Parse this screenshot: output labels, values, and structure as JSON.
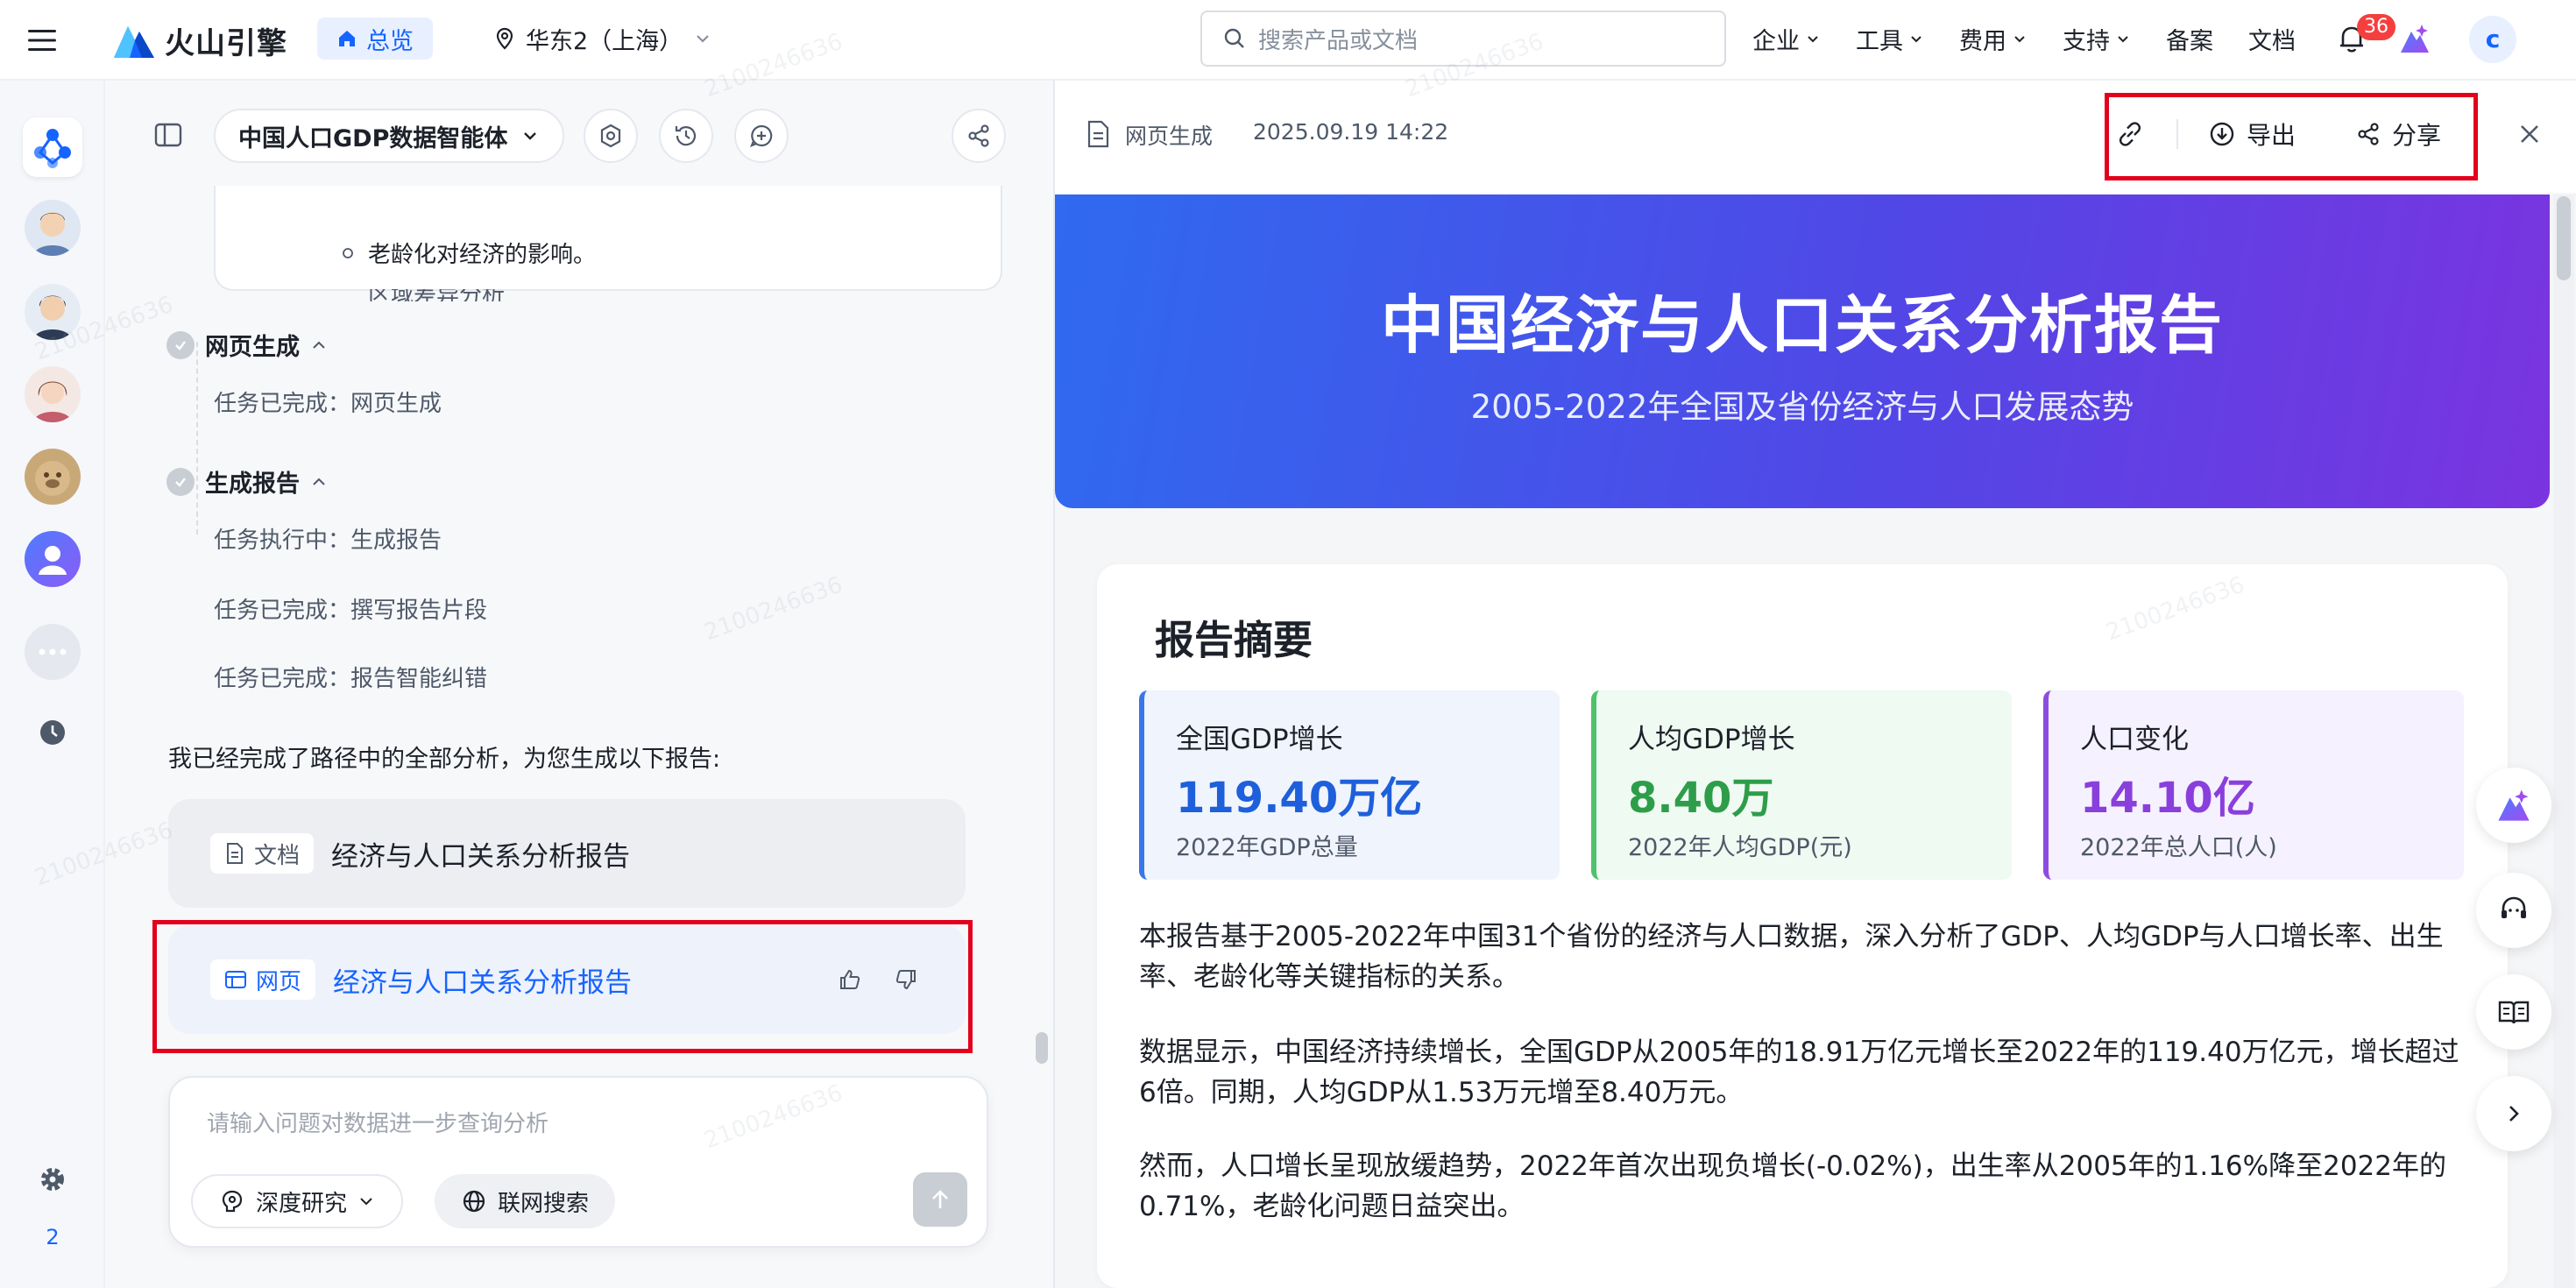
{
  "topnav": {
    "logo": "火山引擎",
    "home": "总览",
    "region": "华东2（上海）",
    "search_placeholder": "搜索产品或文档",
    "menu": [
      "企业",
      "工具",
      "费用",
      "支持"
    ],
    "links": [
      "备案",
      "文档"
    ],
    "notifications": "36",
    "user_initial": "c"
  },
  "rail": {
    "count": "2"
  },
  "chat": {
    "agent_name": "中国人口GDP数据智能体",
    "outline_item": "老龄化对经济的影响。",
    "outline_cut": "区域差异分析",
    "steps": [
      {
        "title": "网页生成",
        "tasks": [
          "任务已完成：网页生成"
        ]
      },
      {
        "title": "生成报告",
        "tasks": [
          "任务执行中：生成报告",
          "任务已完成：撰写报告片段",
          "任务已完成：报告智能纠错"
        ]
      }
    ],
    "summary": "我已经完成了路径中的全部分析，为您生成以下报告:",
    "results": [
      {
        "type": "文档",
        "title": "经济与人口关系分析报告"
      },
      {
        "type": "网页",
        "title": "经济与人口关系分析报告"
      }
    ],
    "composer": {
      "placeholder": "请输入问题对数据进一步查询分析",
      "deep_research": "深度研究",
      "web_search": "联网搜索"
    }
  },
  "preview": {
    "type": "网页生成",
    "timestamp": "2025.09.19 14:22",
    "export": "导出",
    "share": "分享",
    "hero_title": "中国经济与人口关系分析报告",
    "hero_subtitle": "2005-2022年全国及省份经济与人口发展态势",
    "section_title": "报告摘要",
    "stats": [
      {
        "label": "全国GDP增长",
        "value": "119.40万亿",
        "note": "2022年GDP总量"
      },
      {
        "label": "人均GDP增长",
        "value": "8.40万",
        "note": "2022年人均GDP(元)"
      },
      {
        "label": "人口变化",
        "value": "14.10亿",
        "note": "2022年总人口(人)"
      }
    ],
    "paragraphs": [
      "本报告基于2005-2022年中国31个省份的经济与人口数据，深入分析了GDP、人均GDP与人口增长率、出生率、老龄化等关键指标的关系。",
      "数据显示，中国经济持续增长，全国GDP从2005年的18.91万亿元增长至2022年的119.40万亿元，增长超过6倍。同期，人均GDP从1.53万元增至8.40万元。",
      "然而，人口增长呈现放缓趋势，2022年首次出现负增长(-0.02%)，出生率从2005年的1.16%降至2022年的0.71%，老龄化问题日益突出。"
    ]
  },
  "watermark": "2100246636",
  "colors": {
    "accent": "#1664ff",
    "highlight": "#e3001b",
    "hero_start": "#2f6af0",
    "hero_end": "#7a34e0"
  }
}
